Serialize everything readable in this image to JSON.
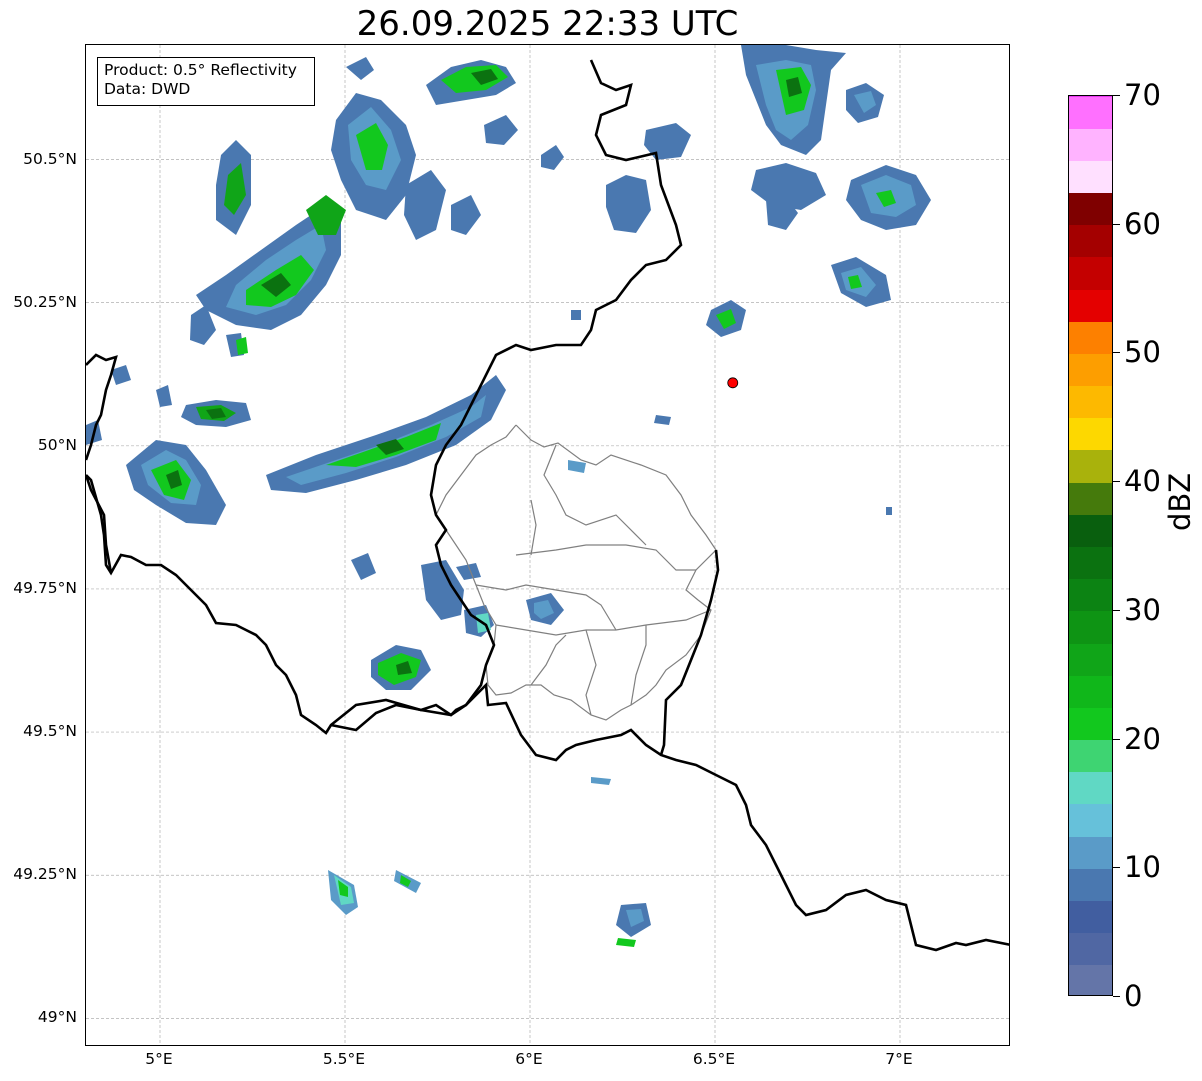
{
  "title": "26.09.2025 22:33 UTC",
  "info": {
    "product": "Product: 0.5° Reflectivity",
    "source": "Data: DWD"
  },
  "map": {
    "lon_range": [
      4.8,
      7.3
    ],
    "lat_range": [
      48.95,
      50.7
    ],
    "lat_ticks": [
      {
        "value": 50.5,
        "label": "50.5°N"
      },
      {
        "value": 50.25,
        "label": "50.25°N"
      },
      {
        "value": 50.0,
        "label": "50°N"
      },
      {
        "value": 49.75,
        "label": "49.75°N"
      },
      {
        "value": 49.5,
        "label": "49.5°N"
      },
      {
        "value": 49.25,
        "label": "49.25°N"
      },
      {
        "value": 49.0,
        "label": "49°N"
      }
    ],
    "lon_ticks": [
      {
        "value": 5.0,
        "label": "5°E"
      },
      {
        "value": 5.5,
        "label": "5.5°E"
      },
      {
        "value": 6.0,
        "label": "6°E"
      },
      {
        "value": 6.5,
        "label": "6.5°E"
      },
      {
        "value": 7.0,
        "label": "7°E"
      }
    ],
    "radar_site": {
      "lon": 6.548,
      "lat": 50.11,
      "color": "#ff0000"
    },
    "grid": true
  },
  "colorbar": {
    "unit": "dBZ",
    "min": 0,
    "max": 70,
    "step": 2.5,
    "colors": [
      "#6475a8",
      "#5067a3",
      "#415ea0",
      "#4a78b0",
      "#5a9bc8",
      "#66c1da",
      "#60d8c4",
      "#3ed472",
      "#12c81e",
      "#10b71a",
      "#10a518",
      "#0e9414",
      "#0c8313",
      "#0b7210",
      "#095f0e",
      "#457a0c",
      "#a9b20c",
      "#fdd800",
      "#fdb900",
      "#fd9e00",
      "#fd8000",
      "#e40000",
      "#c40000",
      "#a40000",
      "#7f0000",
      "#ffe0ff",
      "#ffb3ff",
      "#ff70ff",
      "#e838f0"
    ],
    "ticks": [
      0,
      10,
      20,
      30,
      40,
      50,
      60,
      70
    ]
  }
}
